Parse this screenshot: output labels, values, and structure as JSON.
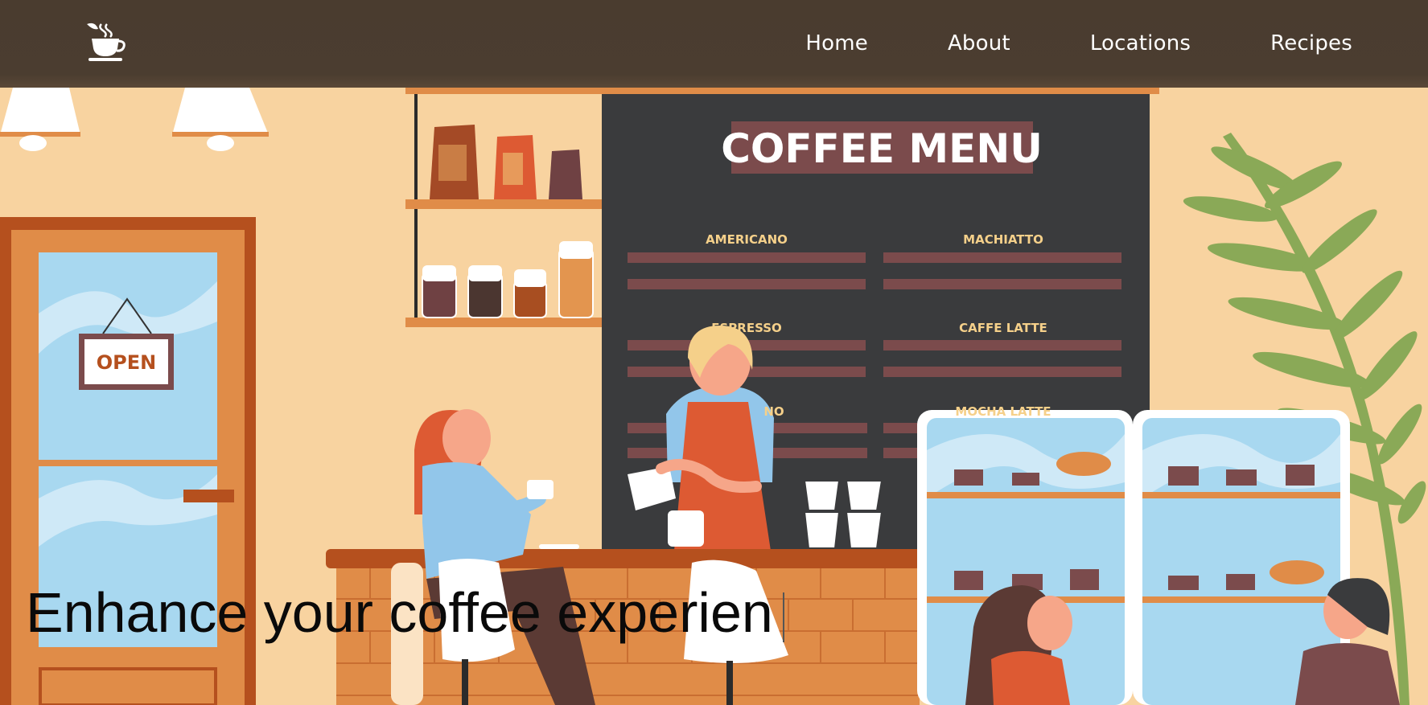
{
  "nav": {
    "logo_icon": "coffee-cup-icon",
    "links": [
      "Home",
      "About",
      "Locations",
      "Recipes"
    ]
  },
  "scene": {
    "menu_title": "COFFEE MENU",
    "menu_items": [
      "AMERICANO",
      "MACHIATTO",
      "ESPRESSO",
      "CAFFE LATTE",
      "NO",
      "MOCHA LATTE"
    ],
    "door_sign": "OPEN"
  },
  "hero": {
    "headline": "Enhance your coffee experien"
  },
  "colors": {
    "navbar": "#4a3c2f",
    "wall": "#f8d3a0",
    "board": "#3a3b3d",
    "menu_title_bg": "#7b4b4c",
    "brick": "#e08c48",
    "glass": "#a8d8f0",
    "plant": "#8aa957"
  }
}
